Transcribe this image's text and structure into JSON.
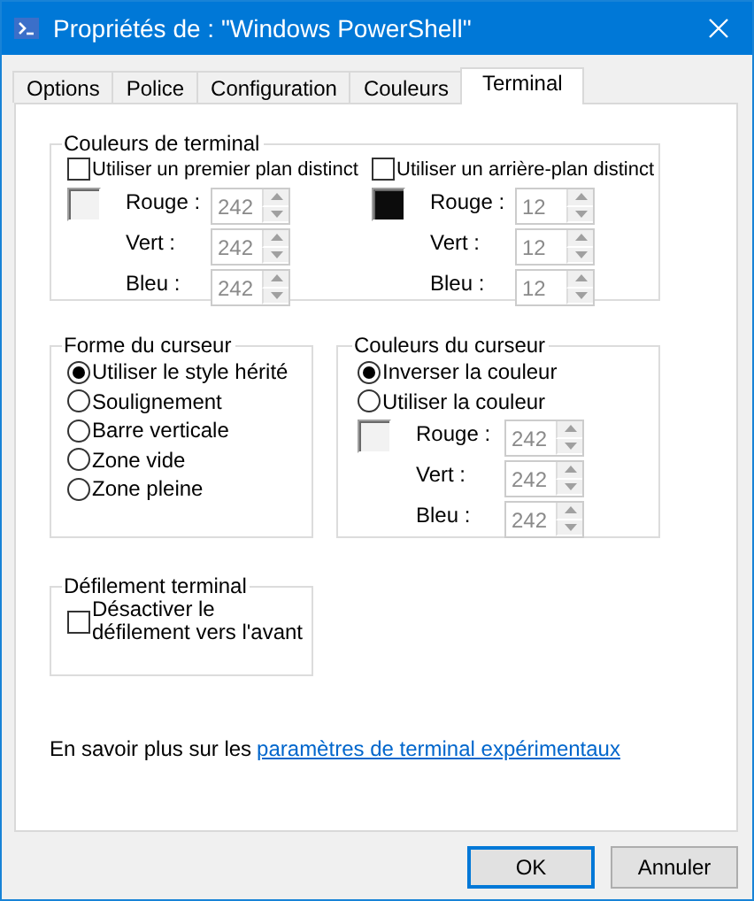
{
  "window": {
    "title": "Propriétés de : \"Windows PowerShell\""
  },
  "tabs": [
    {
      "label": "Options",
      "selected": false
    },
    {
      "label": "Police",
      "selected": false
    },
    {
      "label": "Configuration",
      "selected": false
    },
    {
      "label": "Couleurs",
      "selected": false
    },
    {
      "label": "Terminal",
      "selected": true
    }
  ],
  "terminal_colors": {
    "title": "Couleurs de terminal",
    "columns": [
      {
        "checkbox": {
          "label": "Utiliser un premier plan distinct",
          "checked": false
        },
        "swatch": {
          "color": "#f2f2f2"
        },
        "fields": [
          {
            "label": "Rouge :",
            "value": "242",
            "disabled": true
          },
          {
            "label": "Vert :",
            "value": "242",
            "disabled": true
          },
          {
            "label": "Bleu :",
            "value": "242",
            "disabled": true
          }
        ]
      },
      {
        "checkbox": {
          "label": "Utiliser un arrière-plan distinct",
          "checked": false
        },
        "swatch": {
          "color": "#0c0c0c"
        },
        "fields": [
          {
            "label": "Rouge :",
            "value": "12",
            "disabled": true
          },
          {
            "label": "Vert :",
            "value": "12",
            "disabled": true
          },
          {
            "label": "Bleu :",
            "value": "12",
            "disabled": true
          }
        ]
      }
    ]
  },
  "cursor_shape": {
    "title": "Forme du curseur",
    "options": [
      {
        "label": "Utiliser le style hérité",
        "selected": true
      },
      {
        "label": "Soulignement",
        "selected": false
      },
      {
        "label": "Barre verticale",
        "selected": false
      },
      {
        "label": "Zone vide",
        "selected": false
      },
      {
        "label": "Zone pleine",
        "selected": false
      }
    ]
  },
  "cursor_colors": {
    "title": "Couleurs du curseur",
    "options": [
      {
        "label": "Inverser la couleur",
        "selected": true
      },
      {
        "label": "Utiliser la couleur",
        "selected": false
      }
    ],
    "swatch": {
      "color": "#f2f2f2"
    },
    "fields": [
      {
        "label": "Rouge :",
        "value": "242",
        "disabled": true
      },
      {
        "label": "Vert :",
        "value": "242",
        "disabled": true
      },
      {
        "label": "Bleu :",
        "value": "242",
        "disabled": true
      }
    ]
  },
  "scrolling": {
    "title": "Défilement terminal",
    "checkbox": {
      "label": "Désactiver le défilement vers l'avant",
      "checked": false
    }
  },
  "footer": {
    "text": "En savoir plus sur les",
    "link": "paramètres de terminal expérimentaux"
  },
  "buttons": [
    {
      "label": "OK",
      "default": true
    },
    {
      "label": "Annuler",
      "default": false
    }
  ]
}
